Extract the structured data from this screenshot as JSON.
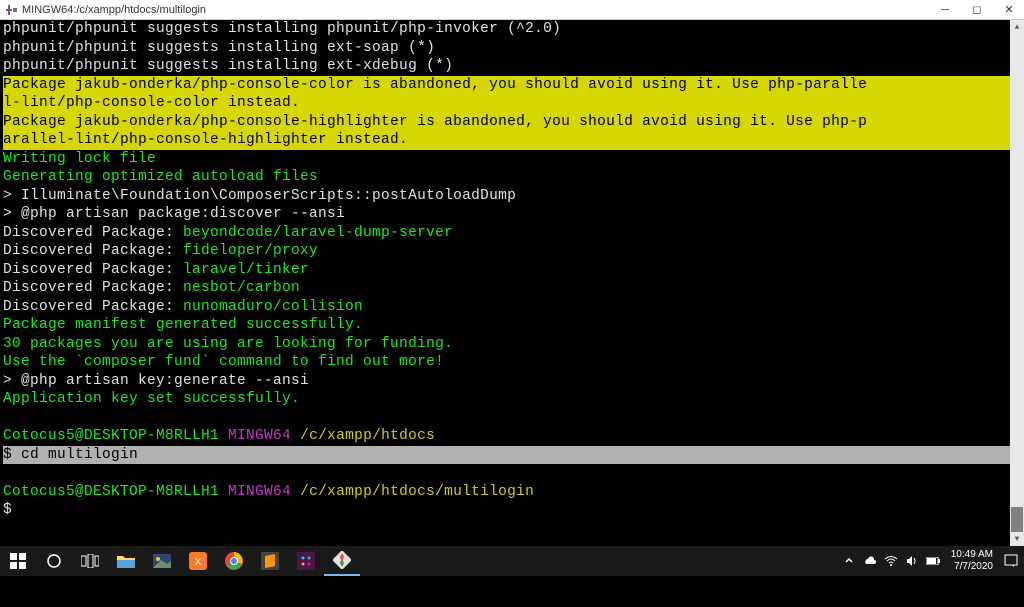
{
  "window": {
    "title": "MINGW64:/c/xampp/htdocs/multilogin"
  },
  "terminal": {
    "l1": "phpunit/phpunit suggests installing phpunit/php-invoker (^2.0)",
    "l2": "phpunit/phpunit suggests installing ext-soap (*)",
    "l3": "phpunit/phpunit suggests installing ext-xdebug (*)",
    "l4": "Package jakub-onderka/php-console-color is abandoned, you should avoid using it. Use php-paralle",
    "l5": "l-lint/php-console-color instead.",
    "l6": "Package jakub-onderka/php-console-highlighter is abandoned, you should avoid using it. Use php-p",
    "l7": "arallel-lint/php-console-highlighter instead.",
    "l8": "Writing lock file",
    "l9": "Generating optimized autoload files",
    "l10": "> Illuminate\\Foundation\\ComposerScripts::postAutoloadDump",
    "l11": "> @php artisan package:discover --ansi",
    "l12a": "Discovered Package: ",
    "l12b": "beyondcode/laravel-dump-server",
    "l13a": "Discovered Package: ",
    "l13b": "fideloper/proxy",
    "l14a": "Discovered Package: ",
    "l14b": "laravel/tinker",
    "l15a": "Discovered Package: ",
    "l15b": "nesbot/carbon",
    "l16a": "Discovered Package: ",
    "l16b": "nunomaduro/collision",
    "l17": "Package manifest generated successfully.",
    "l18": "30 packages you are using are looking for funding.",
    "l19": "Use the `composer fund` command to find out more!",
    "l20": "> @php artisan key:generate --ansi",
    "l21": "Application key set successfully.",
    "blank": " ",
    "p1a": "Cotocus5@DESKTOP-M8RLLH1",
    "p1b": " MINGW64",
    "p1c": " /c/xampp/htdocs",
    "cmd1": "$ cd multilogin",
    "p2a": "Cotocus5@DESKTOP-M8RLLH1",
    "p2b": " MINGW64",
    "p2c": " /c/xampp/htdocs/multilogin",
    "cmd2": "$ "
  },
  "taskbar": {
    "time": "10:49 AM",
    "date": "7/7/2020"
  }
}
